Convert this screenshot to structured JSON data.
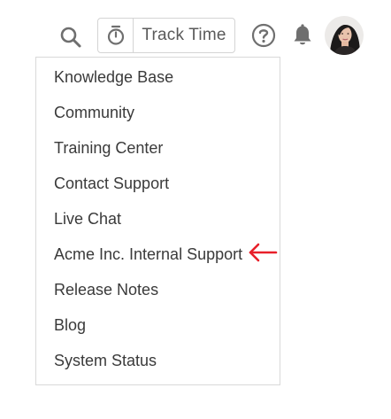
{
  "header": {
    "track_time_label": "Track Time",
    "icons": {
      "search": "search-icon",
      "timer": "timer-icon",
      "help": "help-icon",
      "notifications": "bell-icon",
      "user": "avatar"
    }
  },
  "help_menu": {
    "items": [
      {
        "label": "Knowledge Base"
      },
      {
        "label": "Community"
      },
      {
        "label": "Training Center"
      },
      {
        "label": "Contact Support"
      },
      {
        "label": "Live Chat"
      },
      {
        "label": "Acme Inc. Internal Support"
      },
      {
        "label": "Release Notes"
      },
      {
        "label": "Blog"
      },
      {
        "label": "System Status"
      }
    ]
  },
  "annotation": {
    "arrow_color": "#e8202a",
    "points_to": "Acme Inc. Internal Support"
  },
  "colors": {
    "icon_gray": "#6f6f6f",
    "border": "#d9d9d9",
    "text": "#3a3a3a"
  }
}
